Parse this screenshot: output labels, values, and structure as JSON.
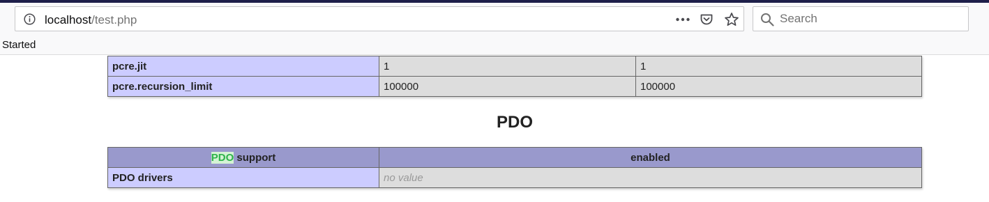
{
  "browser": {
    "url_host": "localhost",
    "url_path": "/test.php",
    "search_placeholder": "Search",
    "status": "Started"
  },
  "pcre_table": {
    "rows": [
      {
        "name": "pcre.jit",
        "local": "1",
        "master": "1"
      },
      {
        "name": "pcre.recursion_limit",
        "local": "100000",
        "master": "100000"
      }
    ]
  },
  "pdo": {
    "title": "PDO",
    "header_highlight": "PDO",
    "header_rest": " support",
    "header_value": "enabled",
    "rows": [
      {
        "name": "PDO drivers",
        "value": "no value"
      }
    ]
  },
  "icons": {
    "info": "info-icon",
    "page_actions": "ellipsis-icon",
    "pocket": "pocket-icon",
    "bookmark": "star-icon",
    "search": "search-icon"
  }
}
